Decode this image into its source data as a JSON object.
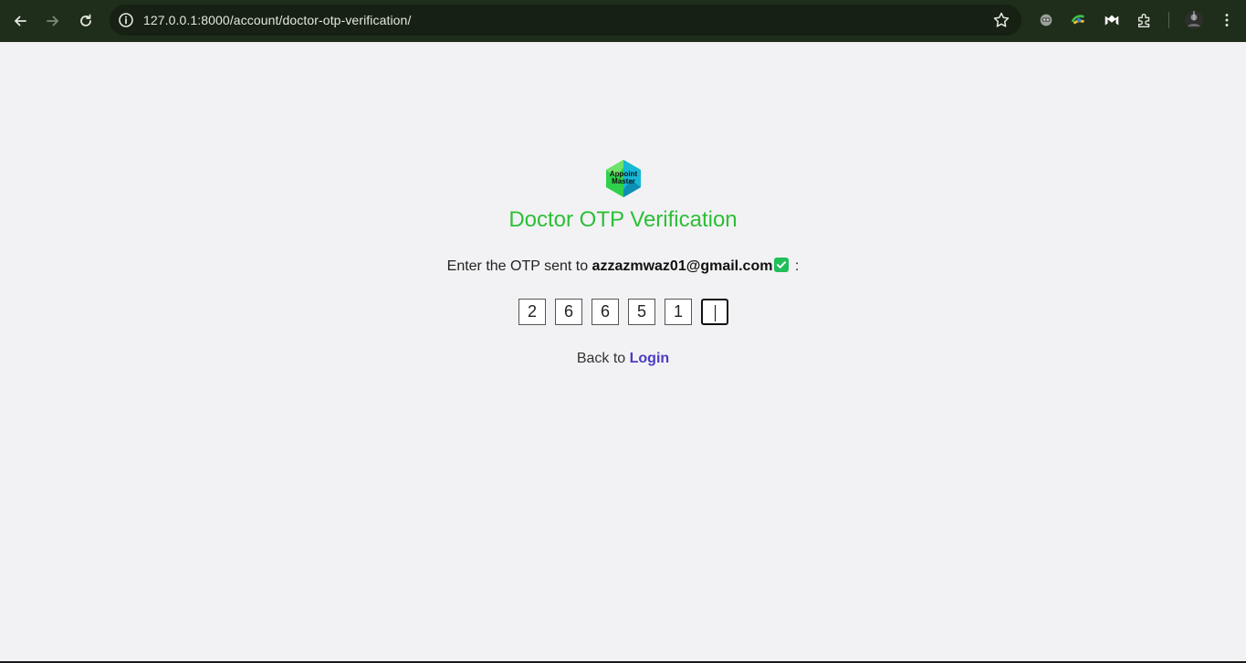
{
  "browser": {
    "url": "127.0.0.1:8000/account/doctor-otp-verification/"
  },
  "page": {
    "logo_text_line1": "Appoint",
    "logo_text_line2": "Master",
    "title": "Doctor OTP Verification",
    "prompt_prefix": "Enter the OTP sent to",
    "email": "azzazmwaz01@gmail.com",
    "prompt_suffix": ":",
    "otp_digits": [
      "2",
      "6",
      "6",
      "5",
      "1",
      ""
    ],
    "back_prefix": "Back to",
    "back_link": "Login"
  },
  "colors": {
    "title": "#2cbf36",
    "link": "#4b3bc4",
    "chrome": "#1f2d1b"
  }
}
